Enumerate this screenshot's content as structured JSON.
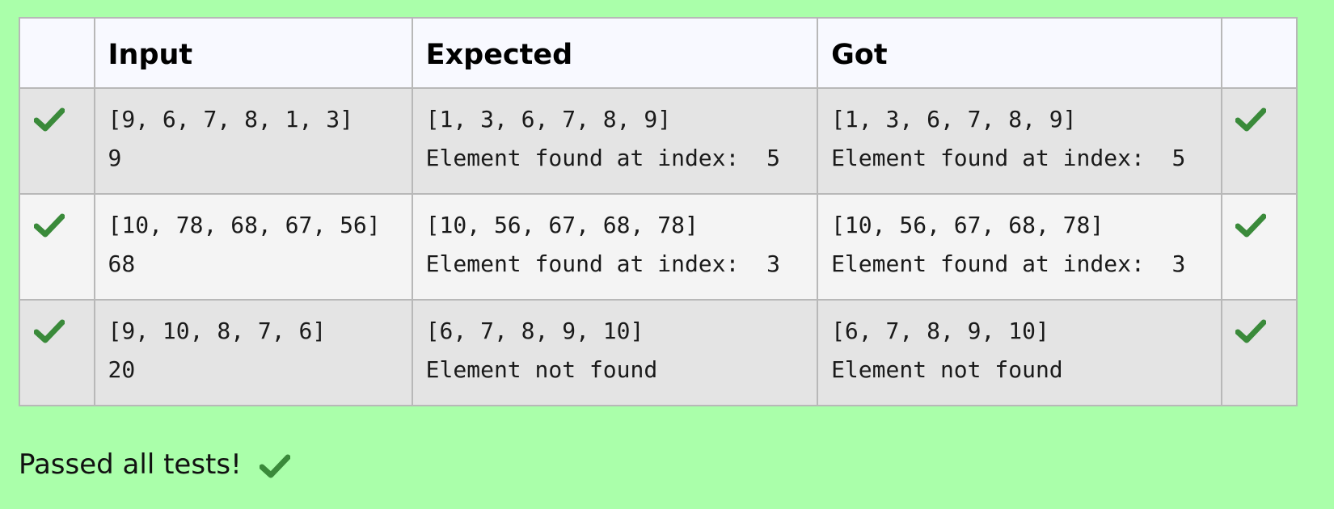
{
  "table": {
    "headers": {
      "status": "",
      "input": "Input",
      "expected": "Expected",
      "got": "Got",
      "result": ""
    },
    "rows": [
      {
        "status_icon": "check-icon",
        "input": [
          "[9, 6, 7, 8, 1, 3]",
          "9"
        ],
        "expected": [
          "[1, 3, 6, 7, 8, 9]",
          "Element found at index:  5"
        ],
        "got": [
          "[1, 3, 6, 7, 8, 9]",
          "Element found at index:  5"
        ],
        "result_icon": "check-icon"
      },
      {
        "status_icon": "check-icon",
        "input": [
          "[10, 78, 68, 67, 56]",
          "68"
        ],
        "expected": [
          "[10, 56, 67, 68, 78]",
          "Element found at index:  3"
        ],
        "got": [
          "[10, 56, 67, 68, 78]",
          "Element found at index:  3"
        ],
        "result_icon": "check-icon"
      },
      {
        "status_icon": "check-icon",
        "input": [
          "[9, 10, 8, 7, 6]",
          "20"
        ],
        "expected": [
          "[6, 7, 8, 9, 10]",
          "Element not found"
        ],
        "got": [
          "[6, 7, 8, 9, 10]",
          "Element not found"
        ],
        "result_icon": "check-icon"
      }
    ]
  },
  "footer": {
    "text": "Passed all tests!",
    "icon": "check-icon"
  },
  "colors": {
    "background": "#aaffaa",
    "header_row": "#f8f9ff",
    "row_odd": "#e4e4e4",
    "row_even": "#f4f4f4",
    "border": "#b8b8b8",
    "check": "#3a8a3a"
  }
}
